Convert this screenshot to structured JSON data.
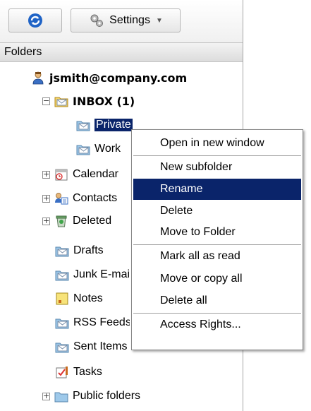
{
  "toolbar": {
    "refresh_icon": "refresh-icon",
    "settings_label": "Settings",
    "settings_icon": "gear-icon"
  },
  "folders_header": "Folders",
  "account": "jsmith@company.com",
  "tree": {
    "inbox": "INBOX (1)",
    "private": "Private",
    "work": "Work",
    "calendar": "Calendar",
    "contacts": "Contacts",
    "deleted": "Deleted",
    "drafts": "Drafts",
    "junk": "Junk E-mail",
    "notes": "Notes",
    "rss": "RSS Feeds",
    "sent": "Sent Items",
    "tasks": "Tasks",
    "public": "Public folders"
  },
  "context_menu": {
    "items": [
      "Open in new window",
      "New subfolder",
      "Rename",
      "Delete",
      "Move to Folder",
      "Mark all as read",
      "Move or copy all",
      "Delete all",
      "Access Rights..."
    ]
  },
  "colors": {
    "selection": "#0a246a",
    "folder": "#f3d36b",
    "mail_folder": "#9ec9ea"
  }
}
